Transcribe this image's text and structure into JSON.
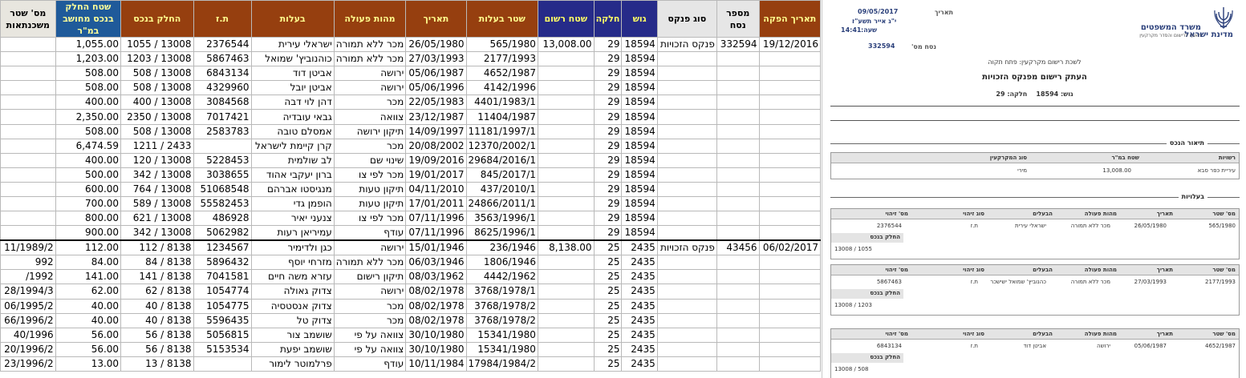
{
  "spreadsheet": {
    "columns": [
      "תאריך הפקה",
      "מספר נסח",
      "סוג פנקס",
      "גוש",
      "חלקה",
      "שטח רשום",
      "שטר בעלות",
      "תאריך",
      "מהות פעולה",
      "בעלות",
      "ת.ז",
      "החלק בנכס",
      "שטח החלק בנכס מחושב במ\"ר",
      "מס' שטר משכנתאות"
    ],
    "rows": [
      [
        "19/12/2016",
        "332594",
        "פנקס הזכויות",
        "18594",
        "29",
        "13,008.00",
        "565/1980",
        "26/05/1980",
        "מכר ללא תמורה",
        "ישראלי עירית",
        "2376544",
        "1055 / 13008",
        "1,055.00",
        ""
      ],
      [
        "",
        "",
        "",
        "18594",
        "29",
        "",
        "2177/1993",
        "27/03/1993",
        "מכר ללא תמורה",
        "כוהנוביץ' שמואל",
        "5867463",
        "1203 / 13008",
        "1,203.00",
        ""
      ],
      [
        "",
        "",
        "",
        "18594",
        "29",
        "",
        "4652/1987",
        "05/06/1987",
        "ירושה",
        "אביטן דוד",
        "6843134",
        "508 / 13008",
        "508.00",
        ""
      ],
      [
        "",
        "",
        "",
        "18594",
        "29",
        "",
        "4142/1996",
        "05/06/1996",
        "ירושה",
        "אביטן יובל",
        "4329960",
        "508 / 13008",
        "508.00",
        ""
      ],
      [
        "",
        "",
        "",
        "18594",
        "29",
        "",
        "4401/1983/1",
        "22/05/1983",
        "מכר",
        "דהן לוי דבה",
        "3084568",
        "400 / 13008",
        "400.00",
        ""
      ],
      [
        "",
        "",
        "",
        "18594",
        "29",
        "",
        "11404/1987",
        "23/12/1987",
        "צוואה",
        "גבאי עובדיה",
        "7017421",
        "2350 / 13008",
        "2,350.00",
        ""
      ],
      [
        "",
        "",
        "",
        "18594",
        "29",
        "",
        "11181/1997/1",
        "14/09/1997",
        "תיקון ירושה",
        "אמסלם טובה",
        "2583783",
        "508 / 13008",
        "508.00",
        ""
      ],
      [
        "",
        "",
        "",
        "18594",
        "29",
        "",
        "12370/2002/1",
        "20/08/2002",
        "מכר",
        "קרן קיימת לישראל",
        "",
        "1211 / 2433",
        "6,474.59",
        ""
      ],
      [
        "",
        "",
        "",
        "18594",
        "29",
        "",
        "29684/2016/1",
        "19/09/2016",
        "שינוי שם",
        "לב שולמית",
        "5228453",
        "120 / 13008",
        "400.00",
        ""
      ],
      [
        "",
        "",
        "",
        "18594",
        "29",
        "",
        "845/2017/1",
        "19/01/2017",
        "מכר לפי צו",
        "ברון יעקבי אהוד",
        "3038655",
        "342 / 13008",
        "500.00",
        ""
      ],
      [
        "",
        "",
        "",
        "18594",
        "29",
        "",
        "437/2010/1",
        "04/11/2010",
        "תיקון טעות",
        "מנגיסטו אברהם",
        "51068548",
        "764 / 13008",
        "600.00",
        ""
      ],
      [
        "",
        "",
        "",
        "18594",
        "29",
        "",
        "24866/2011/1",
        "17/01/2011",
        "תיקון טעות",
        "הופמן גדי",
        "55582453",
        "589 / 13008",
        "700.00",
        ""
      ],
      [
        "",
        "",
        "",
        "18594",
        "29",
        "",
        "3563/1996/1",
        "07/11/1996",
        "מכר לפי צו",
        "צנעני יאיר",
        "486928",
        "621 / 13008",
        "800.00",
        ""
      ],
      [
        "",
        "",
        "",
        "18594",
        "29",
        "",
        "8625/1996/1",
        "07/11/1996",
        "עודף",
        "עמיריאן רעות",
        "5062982",
        "342 / 13008",
        "900.00",
        ""
      ],
      [
        "06/02/2017",
        "43456",
        "פנקס הזכויות",
        "2435",
        "25",
        "8,138.00",
        "236/1946",
        "15/01/1946",
        "ירושה",
        "כגן ולדימיר",
        "1234567",
        "112 / 8138",
        "112.00",
        "11/1989/2"
      ],
      [
        "",
        "",
        "",
        "2435",
        "25",
        "",
        "1806/1946",
        "06/03/1946",
        "מכר ללא תמורה",
        "מזרחי יוסף",
        "5896432",
        "84 / 8138",
        "84.00",
        "992"
      ],
      [
        "",
        "",
        "",
        "2435",
        "25",
        "",
        "4442/1962",
        "08/03/1962",
        "תיקון רישום",
        "עזרא משה חיים",
        "7041581",
        "141 / 8138",
        "141.00",
        "/1992"
      ],
      [
        "",
        "",
        "",
        "2435",
        "25",
        "",
        "3768/1978/1",
        "08/02/1978",
        "ירושה",
        "צדוק גאולה",
        "1054774",
        "62 / 8138",
        "62.00",
        "28/1994/3"
      ],
      [
        "",
        "",
        "",
        "2435",
        "25",
        "",
        "3768/1978/2",
        "08/02/1978",
        "מכר",
        "צדוק אנסטסיה",
        "1054775",
        "40 / 8138",
        "40.00",
        "06/1995/2"
      ],
      [
        "",
        "",
        "",
        "2435",
        "25",
        "",
        "3768/1978/2",
        "08/02/1978",
        "מכר",
        "צדוק טל",
        "5596435",
        "40 / 8138",
        "40.00",
        "66/1996/2"
      ],
      [
        "",
        "",
        "",
        "2435",
        "25",
        "",
        "15341/1980",
        "30/10/1980",
        "צוואה על פי",
        "שושמב צור",
        "5056815",
        "56 / 8138",
        "56.00",
        "40/1996"
      ],
      [
        "",
        "",
        "",
        "2435",
        "25",
        "",
        "15341/1980",
        "30/10/1980",
        "צוואה על פי",
        "שושמב יפעת",
        "5153534",
        "56 / 8138",
        "56.00",
        "20/1996/2"
      ],
      [
        "",
        "",
        "",
        "2435",
        "25",
        "",
        "17984/1984/2",
        "10/11/1984",
        "עודף",
        "פרלמוטר לימור",
        "",
        "13 / 8138",
        "13.00",
        "23/1996/2"
      ]
    ]
  },
  "document": {
    "state_name": "מדינת ישראל",
    "ministry_title": "משרד המשפטים",
    "ministry_subtitle": "האגף לרישום והסדר מקרקעין",
    "date_label": "תאריך",
    "date_value": "09/05/2017",
    "hebrew_date": "י\"ג אייר תשע\"ז",
    "time_label": "שעה:",
    "time_value": "14:41",
    "nesach_label": "נסח מס'",
    "nesach_value": "332594",
    "office": "לשכת רישום מקרקעין: פתח תקוה",
    "title": "העתק רישום מפנקס הזכויות",
    "gush_label": "גוש:",
    "gush_value": "18594",
    "helka_label": "חלקה:",
    "helka_value": "29",
    "property_section": "תיאור הנכס",
    "property_headers": [
      "רשויות",
      "שטח במ\"ר",
      "סוג המקרקעין"
    ],
    "property_values": [
      "עיריית כפר סבא",
      "13,008.00",
      "מירי"
    ],
    "ownership_section": "בעלויות",
    "owner_headers": [
      "מס' שטר",
      "תאריך",
      "מהות פעולה",
      "הבעלים",
      "סוג זיהוי",
      "מס' זיהוי"
    ],
    "share_label": "החלק בנכס",
    "owners": [
      {
        "deed": "565/1980",
        "date": "26/05/1980",
        "action": "מכר ללא תמורה",
        "owner": "ישראלי עירית",
        "id_type": "ת.ז",
        "id": "2376544",
        "share": "1055 / 13008"
      },
      {
        "deed": "2177/1993",
        "date": "27/03/1993",
        "action": "מכר ללא תמורה",
        "owner": "כהנוביץ' שמואל ישישכר",
        "id_type": "ת.ז",
        "id": "5867463",
        "share": "1203 / 13008"
      },
      {
        "deed": "4652/1987",
        "date": "05/06/1987",
        "action": "ירושה",
        "owner": "אביטן דוד",
        "id_type": "ת.ז",
        "id": "6843134",
        "share": "508 / 13008"
      }
    ]
  },
  "colors": {
    "header_brown": "#963f0f",
    "header_navy": "#262b89",
    "header_blue": "#1f5a9a",
    "ministry_blue": "#2a3f7a"
  }
}
